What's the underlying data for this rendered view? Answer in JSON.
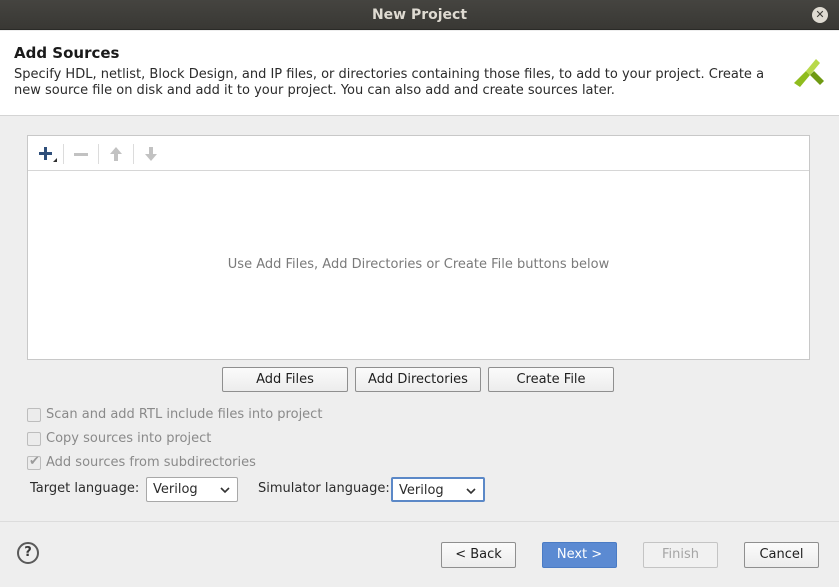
{
  "window": {
    "title": "New Project"
  },
  "header": {
    "title": "Add Sources",
    "description": "Specify HDL, netlist, Block Design, and IP files, or directories containing those files, to add to your project. Create a new source file on disk and add it to your project. You can also add and create sources later."
  },
  "sources": {
    "empty_message": "Use Add Files, Add Directories or Create File buttons below"
  },
  "buttons": {
    "add_files": "Add Files",
    "add_directories": "Add Directories",
    "create_file": "Create File"
  },
  "options": {
    "scan_rtl": {
      "label": "Scan and add RTL include files into project",
      "checked": false
    },
    "copy_sources": {
      "label": "Copy sources into project",
      "checked": false
    },
    "add_subdirs": {
      "label": "Add sources from subdirectories",
      "checked": true
    }
  },
  "languages": {
    "target_label": "Target language:",
    "target_value": "Verilog",
    "simulator_label": "Simulator language:",
    "simulator_value": "Verilog"
  },
  "footer": {
    "help": "?",
    "back": "< Back",
    "next": "Next >",
    "finish": "Finish",
    "cancel": "Cancel"
  },
  "colors": {
    "primary_button": "#5b8ad2",
    "titlebar": "#3c3b37",
    "logo_green": "#8fbc1e"
  },
  "icons": [
    "close-icon",
    "xilinx-logo-icon",
    "plus-icon",
    "minus-icon",
    "arrow-up-icon",
    "arrow-down-icon",
    "chevron-down-icon",
    "help-icon"
  ]
}
